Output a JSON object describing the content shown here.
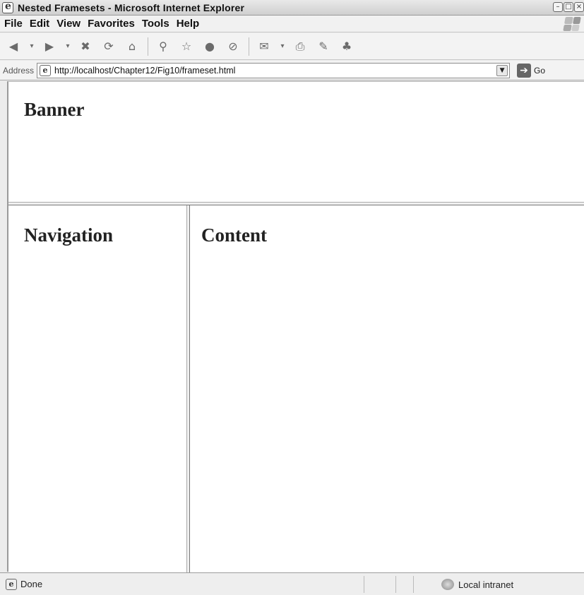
{
  "window": {
    "title": "Nested Framesets - Microsoft Internet Explorer",
    "controls": {
      "minimize": "–",
      "maximize": "□",
      "close": "×"
    }
  },
  "menu": {
    "items": [
      {
        "label": "File"
      },
      {
        "label": "Edit"
      },
      {
        "label": "View"
      },
      {
        "label": "Favorites"
      },
      {
        "label": "Tools"
      },
      {
        "label": "Help"
      }
    ]
  },
  "toolbar": {
    "back_glyph": "◀",
    "dropdown_glyph": "▾",
    "forward_glyph": "▶",
    "stop_glyph": "✖",
    "refresh_glyph": "⟳",
    "home_glyph": "⌂",
    "search_glyph": "⚲",
    "favorites_glyph": "☆",
    "media_glyph": "●",
    "history_glyph": "⊘",
    "mail_glyph": "✉",
    "print_glyph": "⎙",
    "edit_glyph": "✎",
    "messenger_glyph": "♣"
  },
  "address": {
    "label": "Address",
    "icon_glyph": "e",
    "url": "http://localhost/Chapter12/Fig10/frameset.html",
    "dropdown_glyph": "▼",
    "go_glyph": "➔",
    "go_label": "Go"
  },
  "frames": {
    "banner": {
      "heading": "Banner"
    },
    "navigation": {
      "heading": "Navigation"
    },
    "content": {
      "heading": "Content"
    }
  },
  "status": {
    "icon_glyph": "e",
    "text": "Done",
    "zone": "Local intranet"
  }
}
